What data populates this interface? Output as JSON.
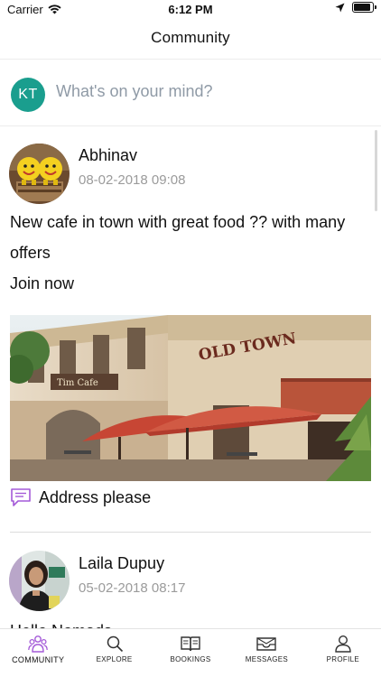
{
  "status_bar": {
    "carrier": "Carrier",
    "time": "6:12 PM",
    "battery_level": 0.9
  },
  "nav": {
    "title": "Community"
  },
  "composer": {
    "initials": "KT",
    "placeholder": "What's on your mind?",
    "avatar_color": "#1a9e8e"
  },
  "posts": [
    {
      "author": "Abhinav",
      "timestamp": "08-02-2018 09:08",
      "body_lines": [
        "New cafe in town with great food ?? with many",
        "offers",
        "Join now"
      ],
      "image_sign_text": "OLD TOWN",
      "comment_text": "Address please",
      "comment_icon": "message-icon"
    },
    {
      "author": "Laila Dupuy",
      "timestamp": "05-02-2018 08:17",
      "body_lines": [
        "Hello Nomads"
      ]
    }
  ],
  "tabs": [
    {
      "label": "COMMUNITY",
      "icon": "community-icon",
      "active": true
    },
    {
      "label": "EXPLORE",
      "icon": "search-icon",
      "active": false
    },
    {
      "label": "BOOKINGS",
      "icon": "book-icon",
      "active": false
    },
    {
      "label": "MESSAGES",
      "icon": "inbox-icon",
      "active": false
    },
    {
      "label": "PROFILE",
      "icon": "person-icon",
      "active": false
    }
  ],
  "colors": {
    "accent_purple": "#a45ad8",
    "timestamp_gray": "#9b9b9b"
  }
}
